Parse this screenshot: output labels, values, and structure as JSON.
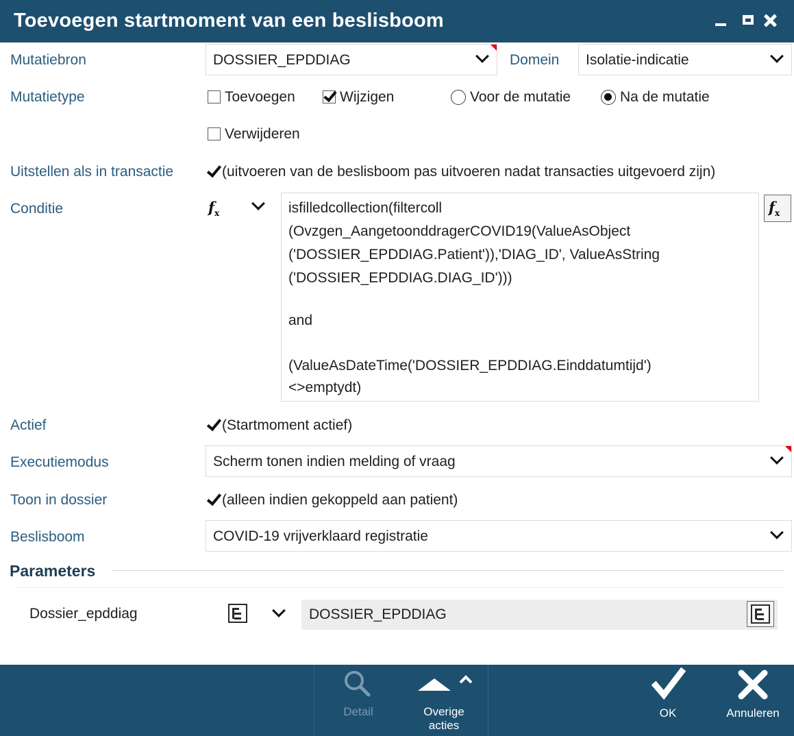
{
  "window": {
    "title": "Toevoegen startmoment van een beslisboom"
  },
  "form": {
    "mutatiebron": {
      "label": "Mutatiebron",
      "value": "DOSSIER_EPDDIAG"
    },
    "domein": {
      "label": "Domein",
      "value": "Isolatie-indicatie"
    },
    "mutatietype": {
      "label": "Mutatietype",
      "toevoegen": {
        "label": "Toevoegen",
        "checked": false
      },
      "wijzigen": {
        "label": "Wijzigen",
        "checked": true
      },
      "verwijderen": {
        "label": "Verwijderen",
        "checked": false
      },
      "voor": {
        "label": "Voor de mutatie",
        "selected": false
      },
      "na": {
        "label": "Na de mutatie",
        "selected": true
      }
    },
    "uitstellen": {
      "label": "Uitstellen als in transactie",
      "checked": true,
      "text": "(uitvoeren van de beslisboom pas uitvoeren nadat transacties uitgevoerd zijn)"
    },
    "conditie": {
      "label": "Conditie",
      "lines": [
        "isfilledcollection(filtercoll",
        "(Ovzgen_AangetoonddragerCOVID19(ValueAsObject",
        "('DOSSIER_EPDDIAG.Patient')),'DIAG_ID', ValueAsString",
        "('DOSSIER_EPDDIAG.DIAG_ID')))",
        "",
        "and",
        "",
        "(ValueAsDateTime('DOSSIER_EPDDIAG.Einddatumtijd')",
        "<>emptydt)"
      ]
    },
    "actief": {
      "label": "Actief",
      "checked": true,
      "text": "(Startmoment actief)"
    },
    "executiemodus": {
      "label": "Executiemodus",
      "value": "Scherm tonen indien melding of vraag"
    },
    "toon_in_dossier": {
      "label": "Toon in dossier",
      "checked": true,
      "text": "(alleen indien gekoppeld aan patient)"
    },
    "beslisboom": {
      "label": "Beslisboom",
      "value": "COVID-19 vrijverklaard registratie"
    }
  },
  "parameters": {
    "title": "Parameters",
    "items": [
      {
        "name": "Dossier_epddiag",
        "value": "DOSSIER_EPDDIAG"
      }
    ]
  },
  "toolbar": {
    "detail_label": "Detail",
    "overige_line1": "Overige",
    "overige_line2": "acties",
    "ok_label": "OK",
    "annuleren_label": "Annuleren"
  },
  "colors": {
    "titlebar": "#1d4f6f",
    "label": "#2a5d80",
    "required_marker": "#e8000b"
  },
  "icons": {
    "search": "search-icon",
    "expand_up": "triangle-up-icon",
    "ok": "checkmark-icon",
    "cancel": "cross-icon",
    "formula": "fx-icon",
    "tree": "tree-icon"
  }
}
